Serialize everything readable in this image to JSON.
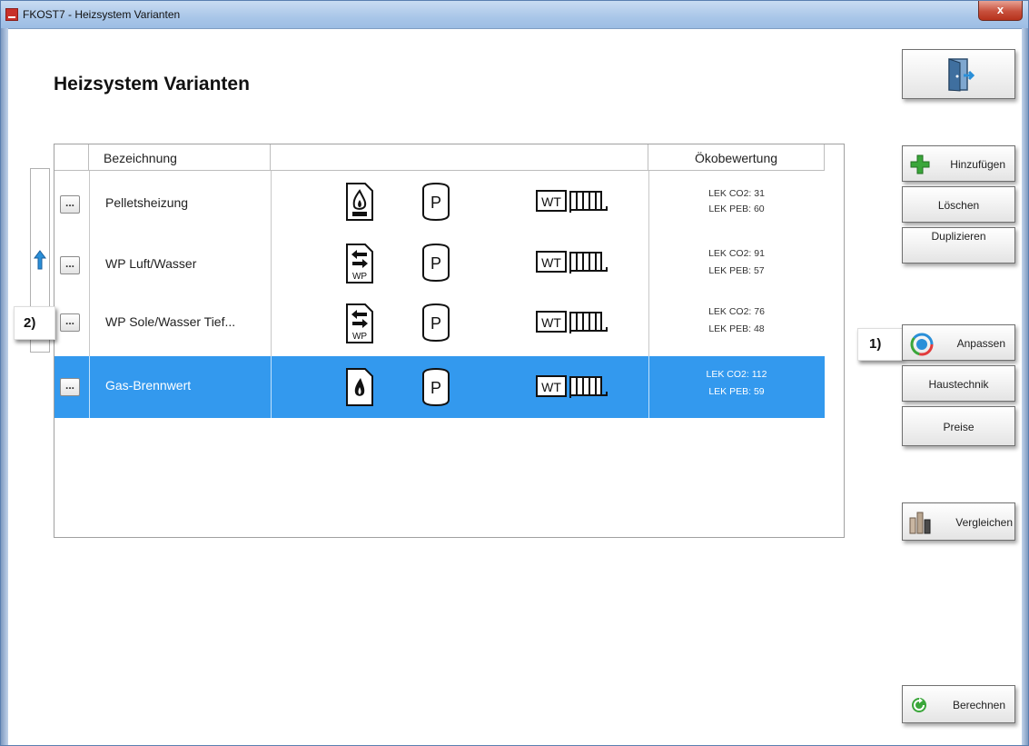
{
  "window": {
    "title": "FKOST7 - Heizsystem Varianten",
    "close_label": "x"
  },
  "page": {
    "title": "Heizsystem Varianten"
  },
  "table": {
    "headers": [
      "Bezeichnung",
      "",
      "Ökobewertung"
    ],
    "rows": [
      {
        "button": "...",
        "name": "Pelletsheizung",
        "heat_icon": "pellet-flame-icon",
        "storage_icon": "p-storage-icon",
        "distribution_icon": "wt-radiator-icon",
        "co2": "LEK CO2: 31",
        "peb": "LEK PEB: 60",
        "selected": false
      },
      {
        "button": "...",
        "name": "WP Luft/Wasser",
        "heat_icon": "heatpump-wp-icon",
        "storage_icon": "p-storage-icon",
        "distribution_icon": "wt-radiator-icon",
        "co2": "LEK CO2: 91",
        "peb": "LEK PEB: 57",
        "selected": false
      },
      {
        "button": "...",
        "name": "WP Sole/Wasser Tief...",
        "heat_icon": "heatpump-wp-icon",
        "storage_icon": "p-storage-icon",
        "distribution_icon": "wt-radiator-icon",
        "co2": "LEK CO2: 76",
        "peb": "LEK PEB: 48",
        "selected": false
      },
      {
        "button": "...",
        "name": "Gas-Brennwert",
        "heat_icon": "gas-flame-icon",
        "storage_icon": "p-storage-icon",
        "distribution_icon": "wt-radiator-icon",
        "co2": "LEK CO2: 112",
        "peb": "LEK PEB: 59",
        "selected": true
      }
    ],
    "icon_text": {
      "p": "P",
      "wt": "WT",
      "wp": "WP"
    }
  },
  "buttons": {
    "hinzufuegen": "Hinzufügen",
    "loeschen": "Löschen",
    "duplizieren": "Duplizieren",
    "anpassen": "Anpassen",
    "haustechnik": "Haustechnik",
    "preise": "Preise",
    "vergleichen": "Vergleichen",
    "berechnen": "Berechnen"
  },
  "annotations": {
    "one": "1)",
    "two": "2)"
  },
  "colors": {
    "selection": "#3399ee",
    "titlebar": "#a9c6e8",
    "add_green": "#3aa63a",
    "arrow_blue": "#2a8fd8"
  }
}
